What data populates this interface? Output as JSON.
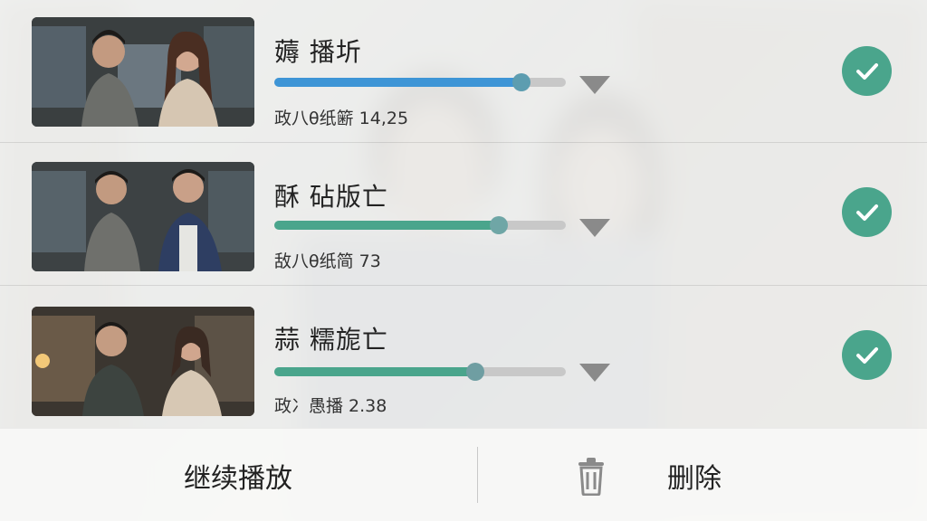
{
  "colors": {
    "accent_blue": "#3e95d6",
    "accent_green": "#4aa58c",
    "check_bg": "#4aa58c"
  },
  "items": [
    {
      "title": "薅 播圻",
      "progress": 0.85,
      "progress_color": "blue",
      "meta": "政八θ纸簖 14,25",
      "selected": true
    },
    {
      "title": "酥 砧版亡",
      "progress": 0.77,
      "progress_color": "green",
      "meta": "敌八θ纸简 73",
      "selected": true
    },
    {
      "title": "蒜 糯旎亡",
      "progress": 0.69,
      "progress_color": "green",
      "meta": "政冫愚播 2.38",
      "selected": true
    }
  ],
  "toolbar": {
    "continue_label": "继续播放",
    "delete_icon": "trash-icon",
    "delete_label": "删除"
  }
}
